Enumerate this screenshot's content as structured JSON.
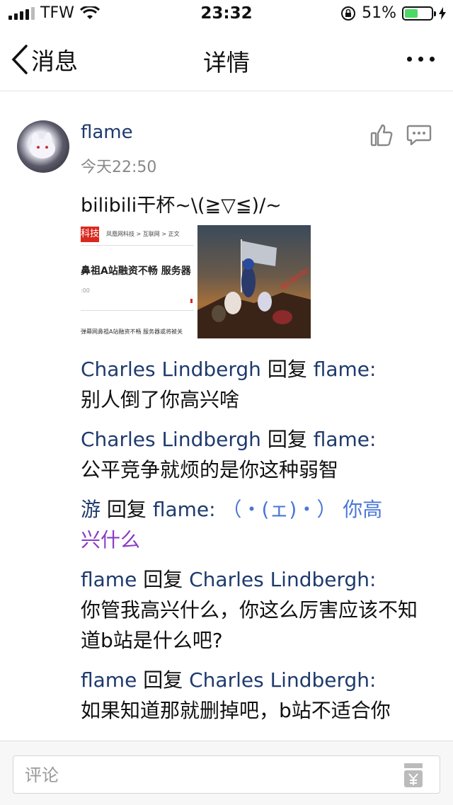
{
  "status_bar": {
    "carrier": "TFW",
    "time": "23:32",
    "battery": "51%",
    "battery_level": 0.51
  },
  "nav": {
    "back_label": "消息",
    "title": "详情"
  },
  "post": {
    "author": "flame",
    "time": "今天22:50",
    "content": "bilibili干杯~\\(≧▽≦)/~",
    "image1": {
      "tag": "科技",
      "breadcrumb": "凤凰网科技 > 互联网 > 正文",
      "headline": "鼻祖A站融资不畅 服务器",
      "time": ":00",
      "caption": "弹幕网鼻祖A站融资不畅 服务器或将被关"
    },
    "image2": {
      "banner": "我们胜利啦!"
    }
  },
  "replies": [
    {
      "from": "Charles Lindbergh",
      "verb": "回复",
      "to": "flame:",
      "text": "别人倒了你高兴啥"
    },
    {
      "from": "Charles Lindbergh",
      "verb": "回复",
      "to": "flame:",
      "text": "公平竞争就烦的是你这种弱智"
    },
    {
      "from": "游",
      "verb": "回复",
      "to": "flame:",
      "emoticon": "（・(ェ)・）",
      "text_a": "你高",
      "text_b": "兴什么"
    },
    {
      "from": "flame",
      "verb": "回复",
      "to": "Charles Lindbergh:",
      "text": "你管我高兴什么，你这么厉害应该不知道b站是什么吧?"
    },
    {
      "from": "flame",
      "verb": "回复",
      "to": "Charles Lindbergh:",
      "text": "如果知道那就删掉吧，b站不适合你"
    }
  ],
  "comment": {
    "placeholder": "评论"
  },
  "icons": {
    "back": "chevron-left-icon",
    "more": "more-dots-icon",
    "like": "thumbs-up-icon",
    "comment": "comment-icon",
    "reward": "reward-yen-icon",
    "lock": "orientation-lock-icon",
    "wifi": "wifi-icon",
    "charging": "charging-bolt-icon"
  },
  "colors": {
    "link": "#1e3a6e",
    "emoticon": "#4a77d6",
    "highlight": "#8a3cc6",
    "battery": "#4cd964"
  }
}
